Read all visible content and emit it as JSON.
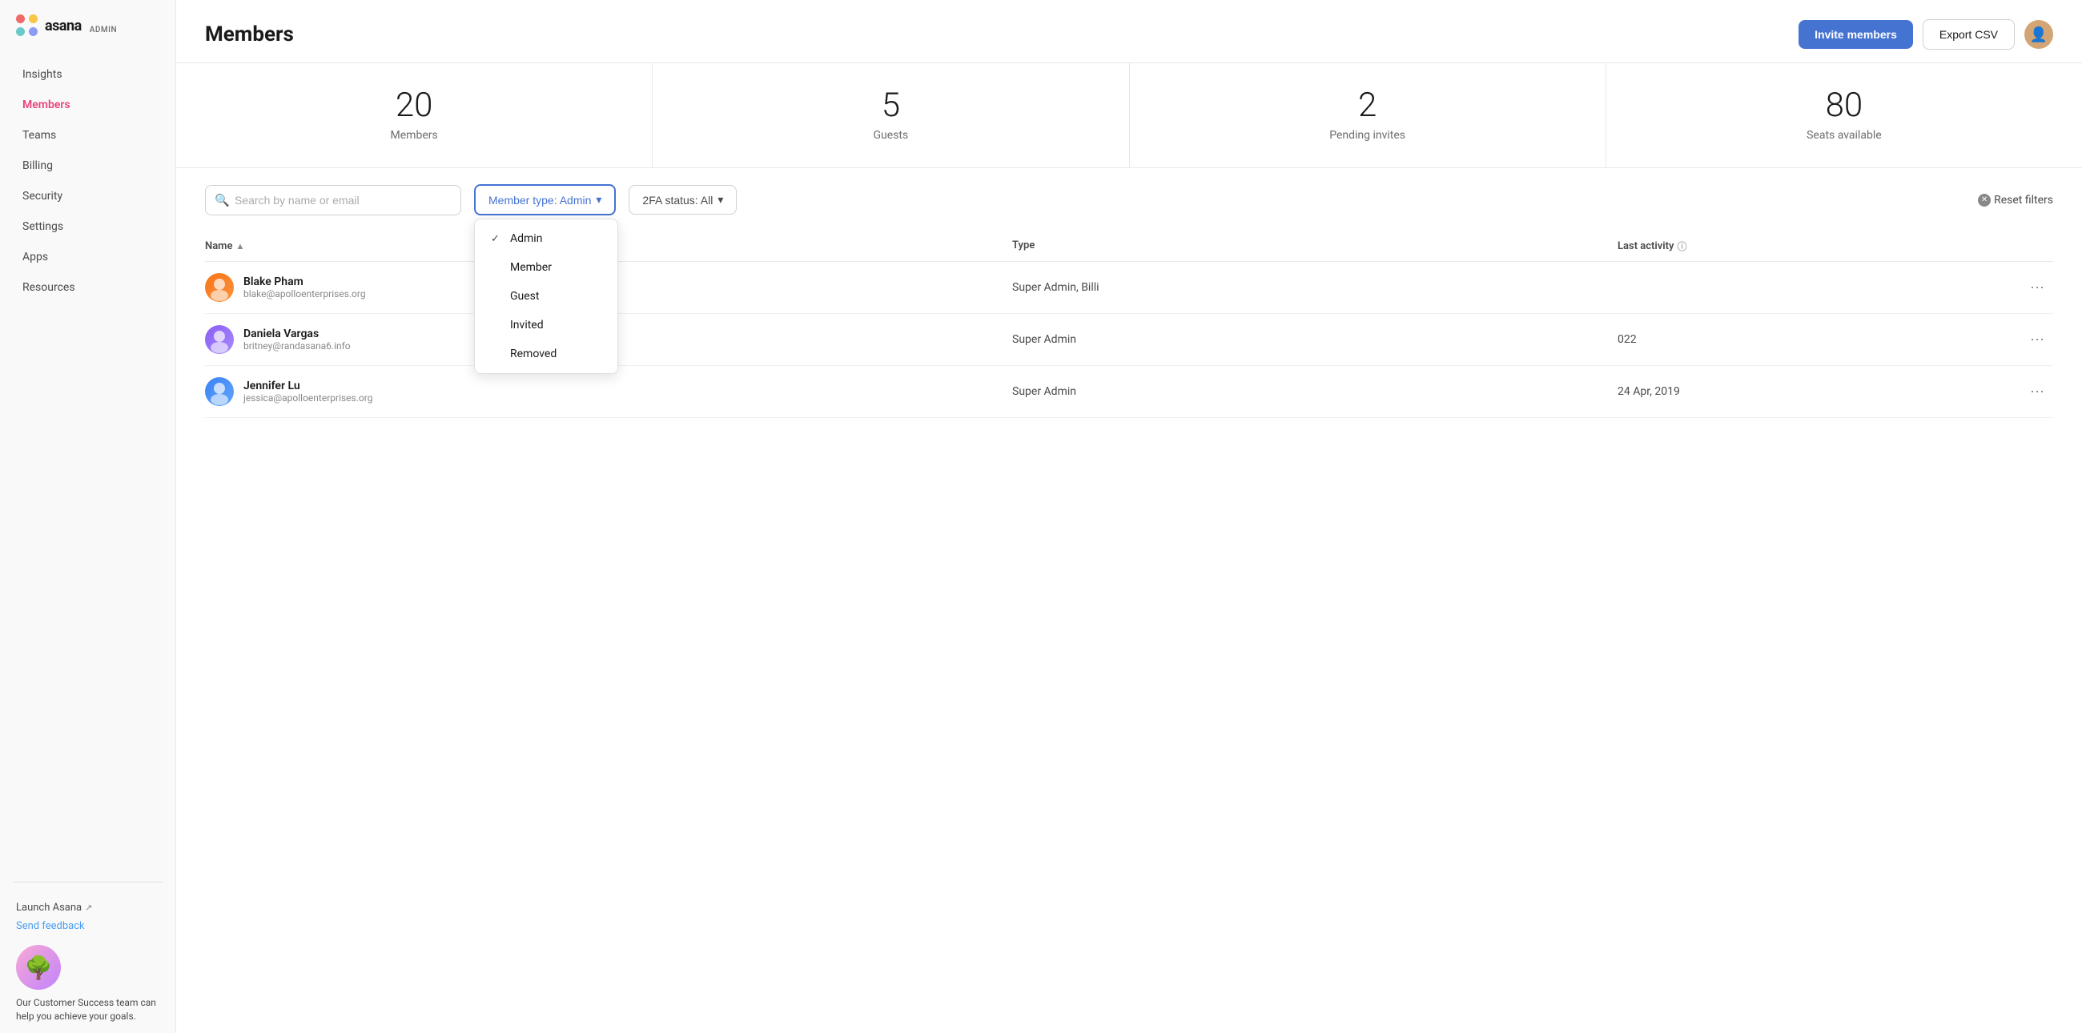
{
  "sidebar": {
    "logo": {
      "wordmark": "asana",
      "admin_label": "ADMIN"
    },
    "nav_items": [
      {
        "id": "insights",
        "label": "Insights",
        "active": false
      },
      {
        "id": "members",
        "label": "Members",
        "active": true
      },
      {
        "id": "teams",
        "label": "Teams",
        "active": false
      },
      {
        "id": "billing",
        "label": "Billing",
        "active": false
      },
      {
        "id": "security",
        "label": "Security",
        "active": false
      },
      {
        "id": "settings",
        "label": "Settings",
        "active": false
      },
      {
        "id": "apps",
        "label": "Apps",
        "active": false
      },
      {
        "id": "resources",
        "label": "Resources",
        "active": false
      }
    ],
    "launch_asana": "Launch Asana",
    "send_feedback": "Send feedback",
    "cs_text": "Our Customer Success team can help you achieve your goals."
  },
  "header": {
    "title": "Members",
    "invite_button": "Invite members",
    "export_button": "Export CSV"
  },
  "stats": [
    {
      "id": "members",
      "number": "20",
      "label": "Members"
    },
    {
      "id": "guests",
      "number": "5",
      "label": "Guests"
    },
    {
      "id": "pending",
      "number": "2",
      "label": "Pending invites"
    },
    {
      "id": "seats",
      "number": "80",
      "label": "Seats available"
    }
  ],
  "filters": {
    "search_placeholder": "Search by name or email",
    "member_type_filter": "Member type: Admin",
    "twofa_filter": "2FA status: All",
    "reset_label": "Reset filters",
    "dropdown_options": [
      {
        "id": "admin",
        "label": "Admin",
        "checked": true
      },
      {
        "id": "member",
        "label": "Member",
        "checked": false
      },
      {
        "id": "guest",
        "label": "Guest",
        "checked": false
      },
      {
        "id": "invited",
        "label": "Invited",
        "checked": false
      },
      {
        "id": "removed",
        "label": "Removed",
        "checked": false
      }
    ]
  },
  "table": {
    "columns": {
      "name": "Name",
      "type": "Type",
      "activity": "Last activity"
    },
    "rows": [
      {
        "id": "blake",
        "name": "Blake Pham",
        "email": "blake@apolloenterprises.org",
        "type": "Super Admin, Billi",
        "activity": ""
      },
      {
        "id": "daniela",
        "name": "Daniela Vargas",
        "email": "britney@randasana6.info",
        "type": "Super Admin",
        "activity": "022"
      },
      {
        "id": "jennifer",
        "name": "Jennifer Lu",
        "email": "jessica@apolloenterprises.org",
        "type": "Super Admin",
        "activity": "24 Apr, 2019"
      }
    ]
  }
}
